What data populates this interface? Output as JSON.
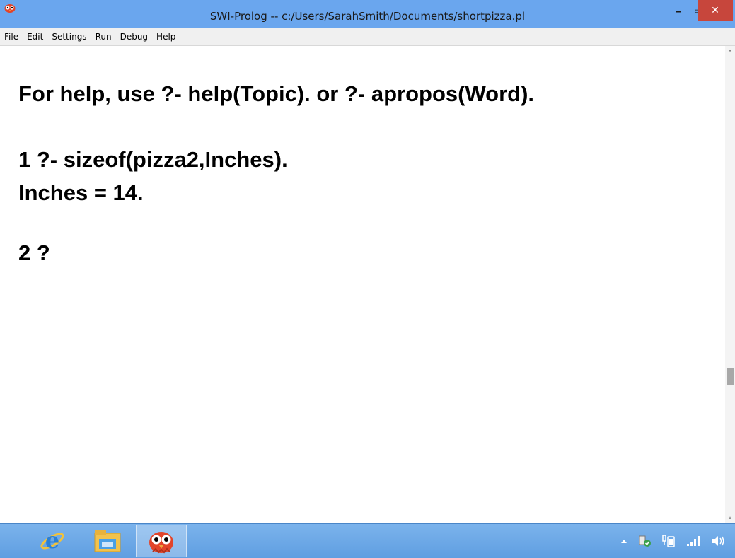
{
  "window": {
    "title": "SWI-Prolog -- c:/Users/SarahSmith/Documents/shortpizza.pl",
    "controls": {
      "minimize": "–",
      "maximize": "▭",
      "close": "✕"
    }
  },
  "menu": {
    "items": [
      "File",
      "Edit",
      "Settings",
      "Run",
      "Debug",
      "Help"
    ]
  },
  "console": {
    "lines": [
      "For help, use ?- help(Topic). or ?- apropos(Word).",
      "1 ?- sizeof(pizza2,Inches).",
      "Inches = 14.",
      "2 ?"
    ]
  },
  "scrollbar": {
    "up_arrow": "^",
    "down_arrow": "v"
  },
  "taskbar": {
    "pinned": [
      {
        "name": "internet-explorer-icon",
        "active": false
      },
      {
        "name": "file-explorer-icon",
        "active": false
      },
      {
        "name": "swi-prolog-icon",
        "active": true
      }
    ],
    "tray": [
      "show-hidden-icons-arrow",
      "action-center-icon",
      "power-icon",
      "network-signal-icon",
      "volume-icon"
    ]
  },
  "colors": {
    "titlebar": "#6aa6ee",
    "close_button": "#c7463c",
    "taskbar": "#6aa6e6",
    "console_text": "#000000"
  }
}
